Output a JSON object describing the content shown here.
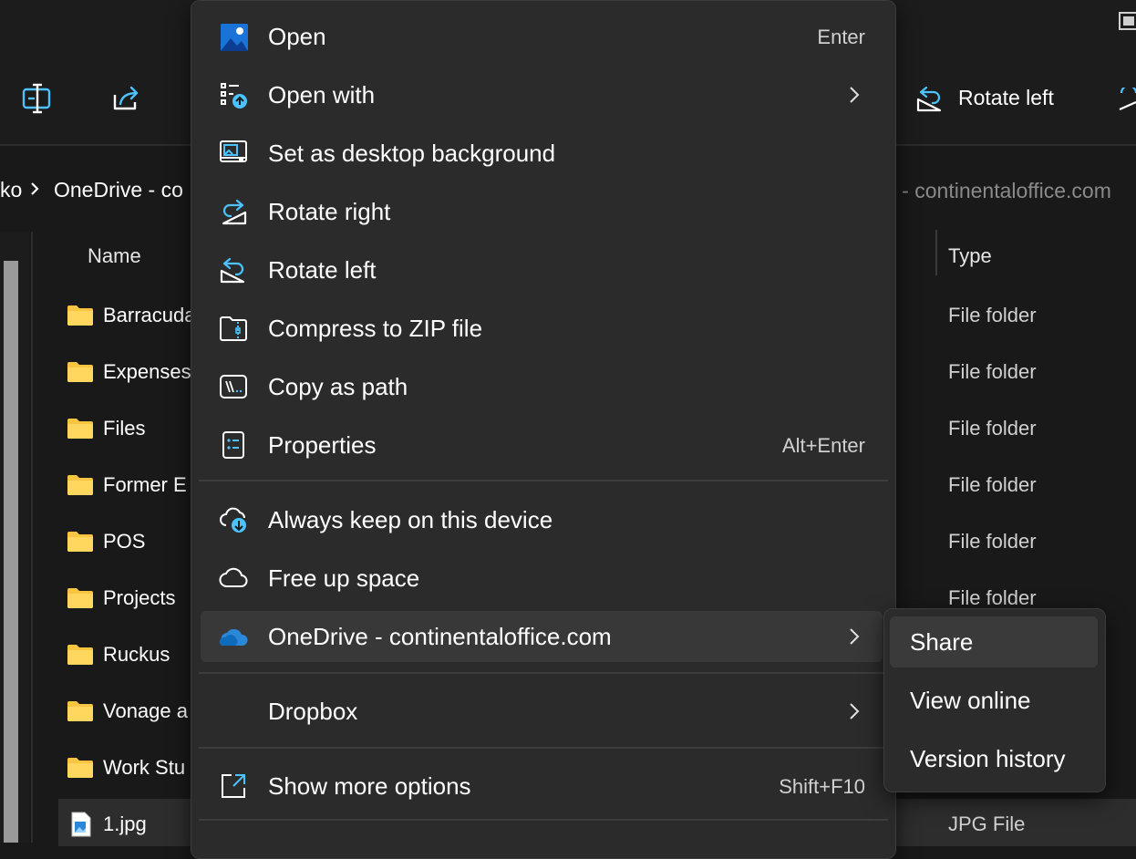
{
  "toolbar": {
    "rotate_left_label": "Rotate left",
    "icons": [
      "rename-icon",
      "share-icon",
      "rotate-left-icon"
    ]
  },
  "address_bar": {
    "crumb_prefix": "ko",
    "crumb_location": "OneDrive - co",
    "search_placeholder": "e - continentaloffice.com"
  },
  "columns": {
    "name": "Name",
    "type": "Type"
  },
  "files": [
    {
      "name": "Barracuda",
      "type": "File folder",
      "icon": "folder-icon"
    },
    {
      "name": "Expenses",
      "type": "File folder",
      "icon": "folder-icon"
    },
    {
      "name": "Files",
      "type": "File folder",
      "icon": "folder-icon"
    },
    {
      "name": "Former E",
      "type": "File folder",
      "icon": "folder-icon"
    },
    {
      "name": "POS",
      "type": "File folder",
      "icon": "folder-icon"
    },
    {
      "name": "Projects",
      "type": "File folder",
      "icon": "folder-icon"
    },
    {
      "name": "Ruckus",
      "type": "File folder",
      "icon": "folder-icon"
    },
    {
      "name": "Vonage a",
      "type": "",
      "icon": "folder-icon"
    },
    {
      "name": "Work Stu",
      "type": "",
      "icon": "folder-icon"
    },
    {
      "name": "1.jpg",
      "type": "JPG File",
      "icon": "image-file-icon"
    }
  ],
  "context_menu": {
    "items": [
      {
        "label": "Open",
        "shortcut": "Enter",
        "icon": "photos-app-icon"
      },
      {
        "label": "Open with",
        "shortcut": "",
        "icon": "open-with-icon",
        "submenu": true
      },
      {
        "label": "Set as desktop background",
        "shortcut": "",
        "icon": "desktop-background-icon"
      },
      {
        "label": "Rotate right",
        "shortcut": "",
        "icon": "rotate-right-icon"
      },
      {
        "label": "Rotate left",
        "shortcut": "",
        "icon": "rotate-left-icon"
      },
      {
        "label": "Compress to ZIP file",
        "shortcut": "",
        "icon": "zip-icon"
      },
      {
        "label": "Copy as path",
        "shortcut": "",
        "icon": "copy-path-icon"
      },
      {
        "label": "Properties",
        "shortcut": "Alt+Enter",
        "icon": "properties-icon"
      },
      {
        "label": "Always keep on this device",
        "shortcut": "",
        "icon": "cloud-download-icon"
      },
      {
        "label": "Free up space",
        "shortcut": "",
        "icon": "cloud-icon"
      },
      {
        "label": "OneDrive - continentaloffice.com",
        "shortcut": "",
        "icon": "onedrive-icon",
        "submenu": true,
        "highlighted": true
      },
      {
        "label": "Dropbox",
        "shortcut": "",
        "icon": "",
        "submenu": true
      },
      {
        "label": "Show more options",
        "shortcut": "Shift+F10",
        "icon": "show-more-icon"
      }
    ]
  },
  "onedrive_submenu": {
    "items": [
      {
        "label": "Share",
        "highlighted": true
      },
      {
        "label": "View online"
      },
      {
        "label": "Version history"
      }
    ]
  },
  "colors": {
    "accent": "#4cc2ff",
    "folder": "#f8c542",
    "onedrive": "#2b88d8",
    "menu_bg": "#2b2b2b",
    "highlight": "#383838"
  }
}
